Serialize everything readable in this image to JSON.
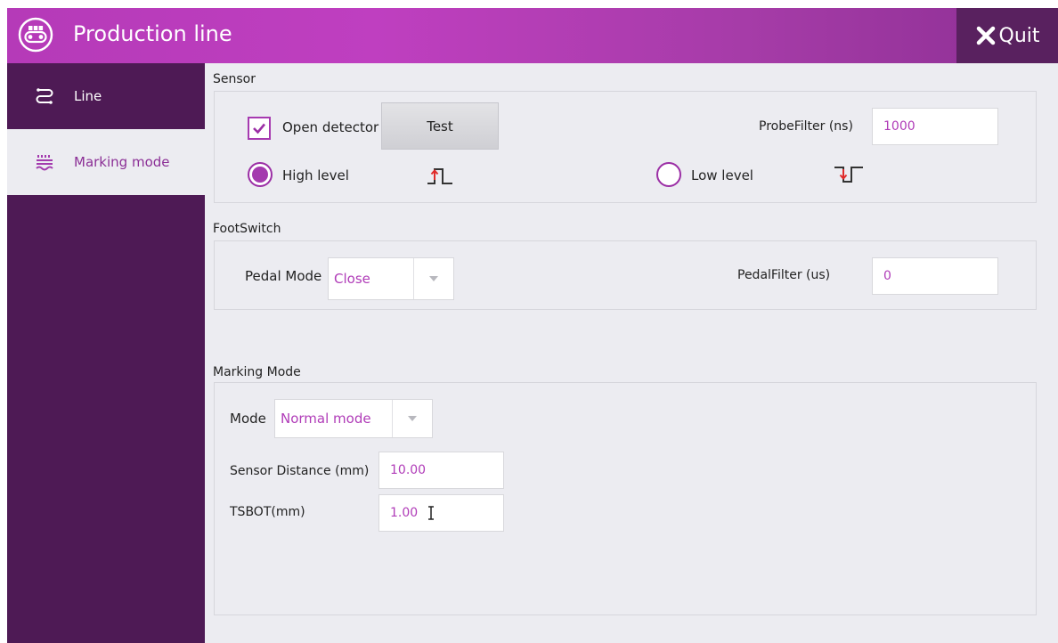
{
  "header": {
    "title": "Production line",
    "quit_label": "Quit"
  },
  "sidebar": {
    "items": [
      {
        "label": "Line",
        "icon": "route-icon"
      },
      {
        "label": "Marking mode",
        "icon": "marking-mode-icon"
      }
    ]
  },
  "sensor": {
    "title": "Sensor",
    "open_detector_label": "Open detector",
    "open_detector_checked": true,
    "test_label": "Test",
    "probe_filter_label": "ProbeFilter (ns)",
    "probe_filter_value": "1000",
    "high_level_label": "High level",
    "high_level_selected": true,
    "low_level_label": "Low level",
    "low_level_selected": false
  },
  "footswitch": {
    "title": "FootSwitch",
    "pedal_mode_label": "Pedal Mode",
    "pedal_mode_value": "Close",
    "pedal_filter_label": "PedalFilter (us)",
    "pedal_filter_value": "0"
  },
  "marking_mode": {
    "title": "Marking Mode",
    "mode_label": "Mode",
    "mode_value": "Normal mode",
    "sensor_distance_label": "Sensor Distance (mm)",
    "sensor_distance_value": "10.00",
    "tsbot_label": "TSBOT(mm)",
    "tsbot_value": "1.00"
  },
  "colors": {
    "accent": "#b53ab8",
    "sidebar_bg": "#4e1a55",
    "quit_bg": "#59215f",
    "panel_bg": "#ececf1"
  }
}
